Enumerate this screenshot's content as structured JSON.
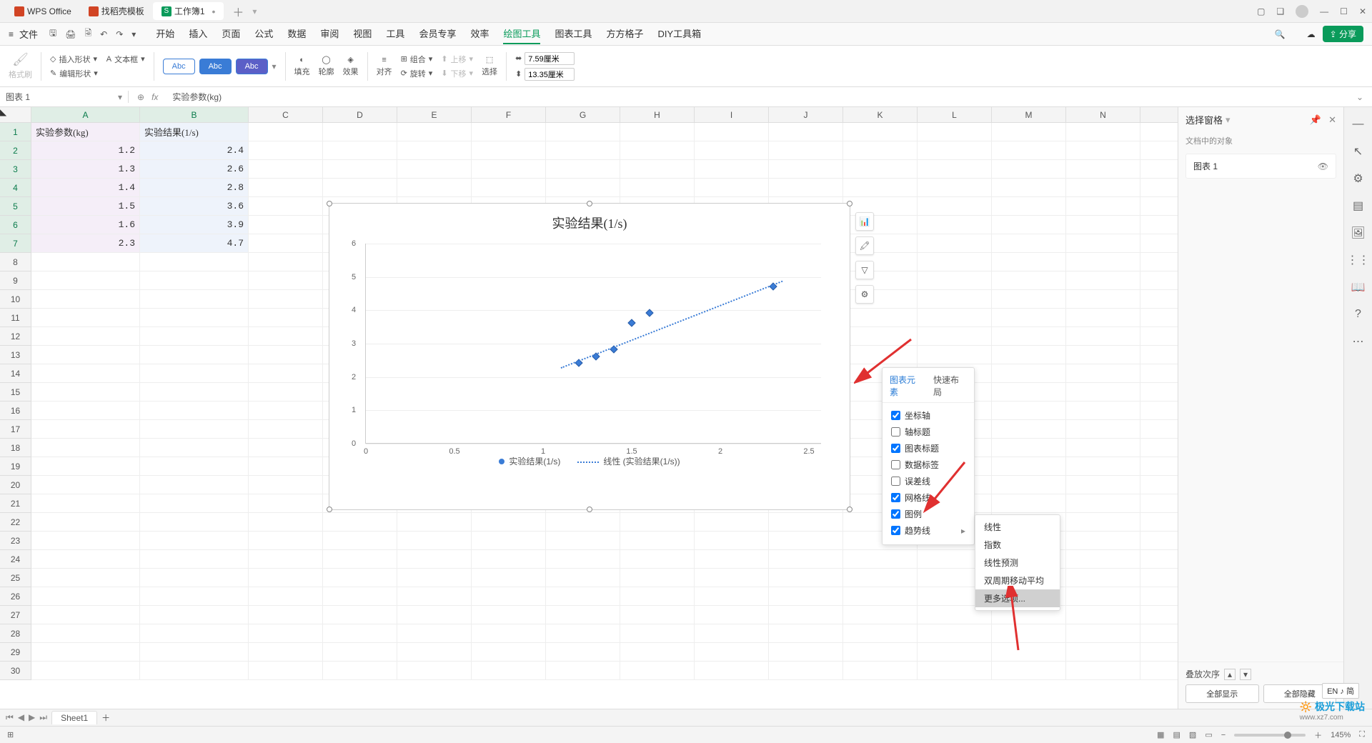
{
  "titlebar": {
    "tab1": "WPS Office",
    "tab2": "找稻壳模板",
    "tab3": "工作簿1"
  },
  "menubar": {
    "file": "文件",
    "tabs": [
      "开始",
      "插入",
      "页面",
      "公式",
      "数据",
      "审阅",
      "视图",
      "工具",
      "会员专享",
      "效率",
      "绘图工具",
      "图表工具",
      "方方格子",
      "DIY工具箱"
    ],
    "active_index": 10,
    "share": "分享"
  },
  "ribbon": {
    "format_painter": "格式刷",
    "insert_shape": "插入形状",
    "edit_shape": "编辑形状",
    "text_box": "文本框",
    "abc": "Abc",
    "fill": "填充",
    "outline": "轮廓",
    "effects": "效果",
    "align": "对齐",
    "group": "组合",
    "rotate": "旋转",
    "up": "上移",
    "down": "下移",
    "select": "选择",
    "width": "7.59厘米",
    "height": "13.35厘米"
  },
  "formula_bar": {
    "namebox": "图表 1",
    "formula": "实验参数(kg)"
  },
  "columns": [
    "A",
    "B",
    "C",
    "D",
    "E",
    "F",
    "G",
    "H",
    "I",
    "J",
    "K",
    "L",
    "M",
    "N"
  ],
  "rows_visible": 30,
  "table": {
    "headers": [
      "实验参数(kg)",
      "实验结果(1/s)"
    ],
    "data": [
      [
        "1.2",
        "2.4"
      ],
      [
        "1.3",
        "2.6"
      ],
      [
        "1.4",
        "2.8"
      ],
      [
        "1.5",
        "3.6"
      ],
      [
        "1.6",
        "3.9"
      ],
      [
        "2.3",
        "4.7"
      ]
    ]
  },
  "chart_data": {
    "type": "scatter",
    "title": "实验结果(1/s)",
    "x": [
      1.2,
      1.3,
      1.4,
      1.5,
      1.6,
      2.3
    ],
    "y": [
      2.4,
      2.6,
      2.8,
      3.6,
      3.9,
      4.7
    ],
    "xlim": [
      0,
      2.5
    ],
    "ylim": [
      0,
      6
    ],
    "xticks": [
      0,
      0.5,
      1,
      1.5,
      2,
      2.5
    ],
    "yticks": [
      0,
      1,
      2,
      3,
      4,
      5,
      6
    ],
    "legend": [
      "实验结果(1/s)",
      "线性 (实验结果(1/s))"
    ],
    "trendline": {
      "type": "linear",
      "from": [
        1.1,
        2.3
      ],
      "to": [
        2.35,
        4.9
      ]
    }
  },
  "popup_elements": {
    "tab1": "图表元素",
    "tab2": "快速布局",
    "items": [
      {
        "label": "坐标轴",
        "checked": true
      },
      {
        "label": "轴标题",
        "checked": false
      },
      {
        "label": "图表标题",
        "checked": true
      },
      {
        "label": "数据标签",
        "checked": false
      },
      {
        "label": "误差线",
        "checked": false
      },
      {
        "label": "网格线",
        "checked": true
      },
      {
        "label": "图例",
        "checked": true
      },
      {
        "label": "趋势线",
        "checked": true,
        "arrow": true
      }
    ]
  },
  "popup_trend": {
    "items": [
      "线性",
      "指数",
      "线性预测",
      "双周期移动平均",
      "更多选项..."
    ],
    "highlight_index": 4
  },
  "right_panel": {
    "title": "选择窗格",
    "sub": "文档中的对象",
    "item": "图表 1",
    "stack": "叠放次序",
    "show_all": "全部显示",
    "hide_all": "全部隐藏"
  },
  "sheet_tabs": {
    "sheet1": "Sheet1"
  },
  "status": {
    "zoom": "145%",
    "ime": "EN ♪ 简"
  },
  "watermark": {
    "name": "极光下载站",
    "url": "www.xz7.com"
  }
}
